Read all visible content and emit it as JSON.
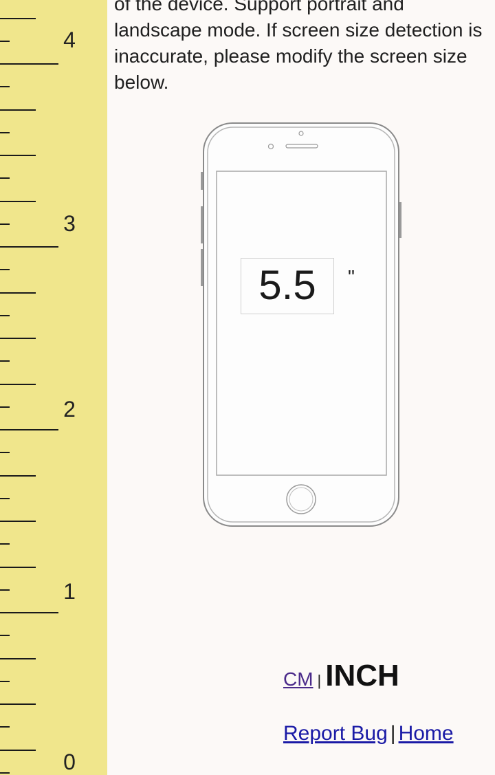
{
  "ruler": {
    "labels": [
      "4",
      "3",
      "2",
      "1",
      "0"
    ]
  },
  "description": "of the device. Support portrait and landscape mode. If screen size detection is inaccurate, please modify the screen size below.",
  "screen_size": {
    "value": "5.5",
    "unit_mark": "\""
  },
  "unit_switch": {
    "cm": "CM",
    "separator": "|",
    "inch": "INCH"
  },
  "footer": {
    "report_bug": "Report Bug",
    "separator": "|",
    "home": "Home"
  },
  "colors": {
    "ruler_background": "#f0e68c",
    "page_background": "#fcf9f7",
    "link": "#1a1aa6",
    "visited_link": "#4a2a8a"
  }
}
